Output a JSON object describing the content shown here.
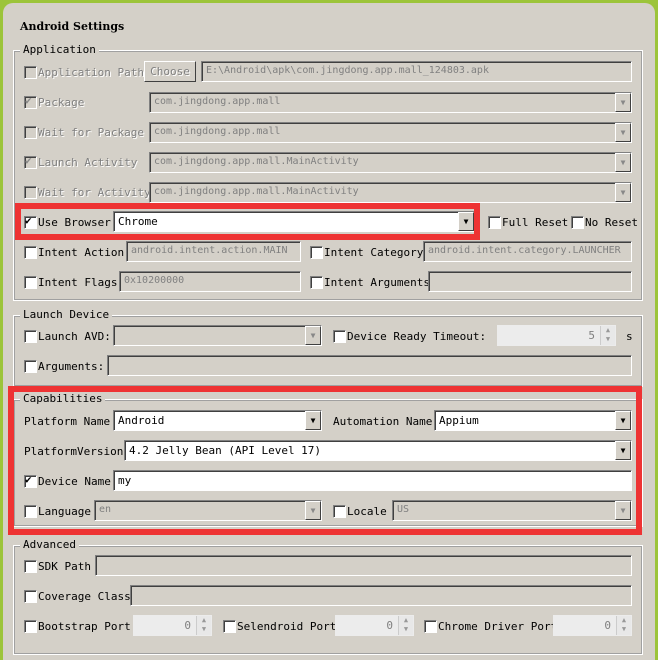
{
  "title": "Android Settings",
  "application": {
    "legend": "Application",
    "app_path": {
      "label": "Application Path",
      "checked": false,
      "button": "Choose",
      "value": "E:\\Android\\apk\\com.jingdong.app.mall_124803.apk"
    },
    "package": {
      "label": "Package",
      "checked": true,
      "value": "com.jingdong.app.mall"
    },
    "wait_package": {
      "label": "Wait for Package",
      "checked": false,
      "value": "com.jingdong.app.mall"
    },
    "launch_activity": {
      "label": "Launch Activity",
      "checked": true,
      "value": "com.jingdong.app.mall.MainActivity"
    },
    "wait_activity": {
      "label": "Wait for Activity",
      "checked": false,
      "value": "com.jingdong.app.mall.MainActivity"
    },
    "use_browser": {
      "label": "Use Browser",
      "checked": true,
      "value": "Chrome"
    },
    "full_reset": {
      "label": "Full Reset",
      "checked": false
    },
    "no_reset": {
      "label": "No Reset",
      "checked": false
    },
    "intent_action": {
      "label": "Intent Action",
      "value": "android.intent.action.MAIN"
    },
    "intent_category": {
      "label": "Intent Category",
      "value": "android.intent.category.LAUNCHER"
    },
    "intent_flags": {
      "label": "Intent Flags",
      "value": "0x10200000"
    },
    "intent_arguments": {
      "label": "Intent Arguments",
      "value": ""
    }
  },
  "launch_device": {
    "legend": "Launch Device",
    "launch_avd": {
      "label": "Launch AVD:",
      "value": ""
    },
    "timeout": {
      "label": "Device Ready Timeout:",
      "value": "5",
      "unit": "s"
    },
    "arguments": {
      "label": "Arguments:",
      "value": ""
    }
  },
  "capabilities": {
    "legend": "Capabilities",
    "platform_name": {
      "label": "Platform Name",
      "value": "Android"
    },
    "automation_name": {
      "label": "Automation Name",
      "value": "Appium"
    },
    "platform_version": {
      "label": "PlatformVersion",
      "value": "4.2 Jelly Bean (API Level 17)"
    },
    "device_name": {
      "label": "Device Name",
      "checked": true,
      "value": "my"
    },
    "language": {
      "label": "Language",
      "value": "en"
    },
    "locale": {
      "label": "Locale",
      "value": "US"
    }
  },
  "advanced": {
    "legend": "Advanced",
    "sdk_path": {
      "label": "SDK Path",
      "value": ""
    },
    "coverage_class": {
      "label": "Coverage Class",
      "value": ""
    },
    "bootstrap_port": {
      "label": "Bootstrap Port",
      "value": "0"
    },
    "selendroid_port": {
      "label": "Selendroid Port",
      "value": "0"
    },
    "chromedriver_port": {
      "label": "Chrome Driver Port",
      "value": "0"
    }
  },
  "colors": {
    "highlight": "#ee3333",
    "frame": "#9cc43a",
    "background": "#d4d0c8"
  }
}
